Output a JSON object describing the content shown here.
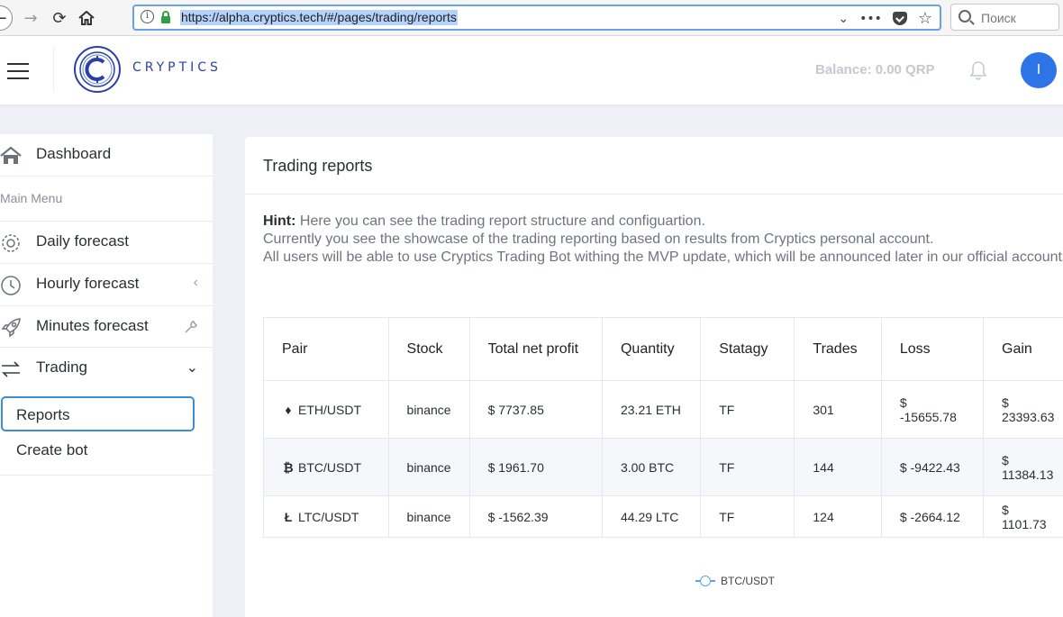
{
  "browser": {
    "url": "https://alpha.cryptics.tech/#/pages/trading/reports",
    "search_placeholder": "Поиск",
    "more_label": "•••"
  },
  "header": {
    "logo_text": "CRYPTICS",
    "balance": "Balance: 0.00 QRP",
    "avatar_initial": "I",
    "accent_color": "#2d74e6"
  },
  "sidebar": {
    "dashboard": "Dashboard",
    "section_label": "Main Menu",
    "items": [
      {
        "label": "Daily forecast",
        "icon": "gear-icon"
      },
      {
        "label": "Hourly forecast",
        "icon": "clock-icon"
      },
      {
        "label": "Minutes forecast",
        "icon": "rocket-icon"
      },
      {
        "label": "Trading",
        "icon": "arrows-icon"
      }
    ],
    "sub_items": [
      "Reports",
      "Create bot"
    ]
  },
  "main": {
    "title": "Trading reports",
    "hint_label": "Hint:",
    "hint_lines": [
      " Here you can see the trading report structure and configuartion.",
      "Currently you see the showcase of the trading reporting based on results from Cryptics personal account.",
      "All users will be able to use Cryptics Trading Bot withing the MVP update, which will be announced later in our official accounts"
    ],
    "table": {
      "headers": [
        "Pair",
        "Stock",
        "Total net profit",
        "Quantity",
        "Statagy",
        "Trades",
        "Loss",
        "Gain"
      ],
      "rows": [
        {
          "coin_icon": "♦",
          "pair": "ETH/USDT",
          "stock": "binance",
          "profit": "$ 7737.85",
          "quantity": "23.21 ETH",
          "strategy": "TF",
          "trades": "301",
          "loss": "$ -15655.78",
          "gain": "$ 23393.63"
        },
        {
          "coin_icon": "₿",
          "pair": "BTC/USDT",
          "stock": "binance",
          "profit": "$ 1961.70",
          "quantity": "3.00 BTC",
          "strategy": "TF",
          "trades": "144",
          "loss": "$ -9422.43",
          "gain": "$ 11384.13"
        },
        {
          "coin_icon": "Ł",
          "pair": "LTC/USDT",
          "stock": "binance",
          "profit": "$ -1562.39",
          "quantity": "44.29 LTC",
          "strategy": "TF",
          "trades": "124",
          "loss": "$ -2664.12",
          "gain": "$ 1101.73"
        }
      ]
    },
    "legend_label": "BTC/USDT"
  }
}
